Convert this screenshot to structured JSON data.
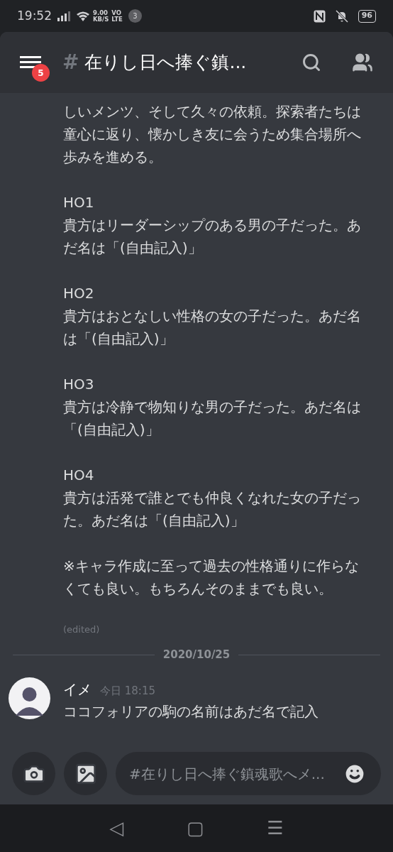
{
  "status_bar": {
    "time": "19:52",
    "speed": "9.00",
    "speed_unit": "KB/S",
    "volte": "VO",
    "lte": "LTE",
    "notification_count": "3",
    "battery": "96"
  },
  "header": {
    "hash": "#",
    "title": "在りし日へ捧ぐ鎮...",
    "unread_badge": "5"
  },
  "messages": [
    {
      "kind": "continuation",
      "paragraphs": [
        {
          "text": "しいメンツ、そして久々の依頼。探索者たちは童心に返り、懐かしき友に会うため集合場所へ歩みを進める。"
        },
        {
          "heading": "HO1",
          "text": "貴方はリーダーシップのある男の子だった。あだ名は「(自由記入)」"
        },
        {
          "heading": "HO2",
          "text": "貴方はおとなしい性格の女の子だった。あだ名は「(自由記入)」"
        },
        {
          "heading": "HO3",
          "text": "貴方は冷静で物知りな男の子だった。あだ名は「(自由記入)」"
        },
        {
          "heading": "HO4",
          "text": "貴方は活発で誰とでも仲良くなれた女の子だった。あだ名は「(自由記入)」"
        },
        {
          "text": "※キャラ作成に至って過去の性格通りに作らなくても良い。もちろんそのままでも良い。"
        }
      ],
      "edited": "(edited)"
    },
    {
      "kind": "divider",
      "date": "2020/10/25"
    },
    {
      "kind": "post",
      "author": "イメ",
      "time": "今日 18:15",
      "text": "ココフォリアの駒の名前はあだ名で記入"
    }
  ],
  "composer": {
    "placeholder": "#在りし日へ捧ぐ鎮魂歌へメ..."
  },
  "nav_bar": {
    "back": "◁",
    "home": "▢",
    "menu": "☰"
  }
}
